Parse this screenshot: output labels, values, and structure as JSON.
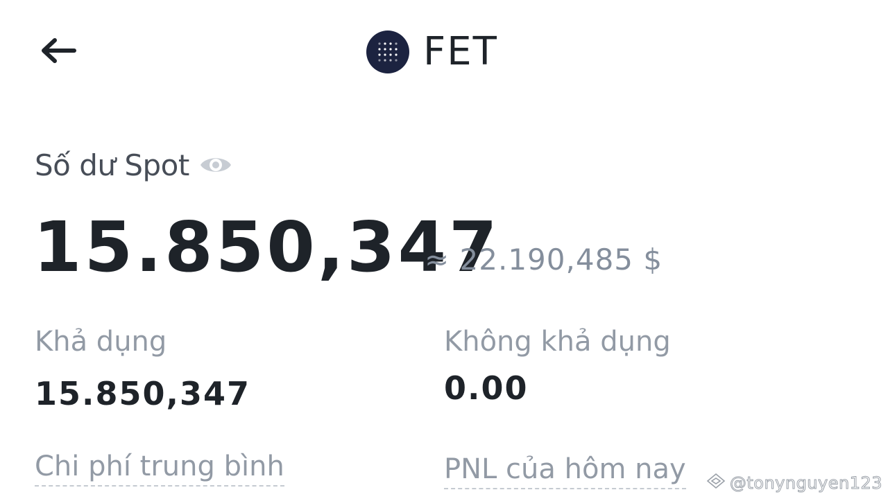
{
  "header": {
    "coin_symbol": "FET",
    "back_icon": "arrow-left-icon",
    "coin_icon": "fet-coin-logo"
  },
  "balance": {
    "label": "Số dư Spot",
    "eye_icon": "eye-icon",
    "amount": "15.850,347",
    "approx_value": "≈ 22.190,485 $"
  },
  "details": {
    "available_label": "Khả dụng",
    "available_value": "15.850,347",
    "unavailable_label": "Không khả dụng",
    "unavailable_value": "0.00",
    "avg_cost_label": "Chi phí trung bình",
    "pnl_today_label": "PNL của hôm nay"
  },
  "watermark": {
    "text": "@tonynguyen123",
    "icon": "tiktok-like-logo"
  },
  "colors": {
    "primary_text": "#1e2329",
    "secondary_text": "#929aa5",
    "approx_text": "#848e9c",
    "coin_bg": "#1c2340"
  }
}
